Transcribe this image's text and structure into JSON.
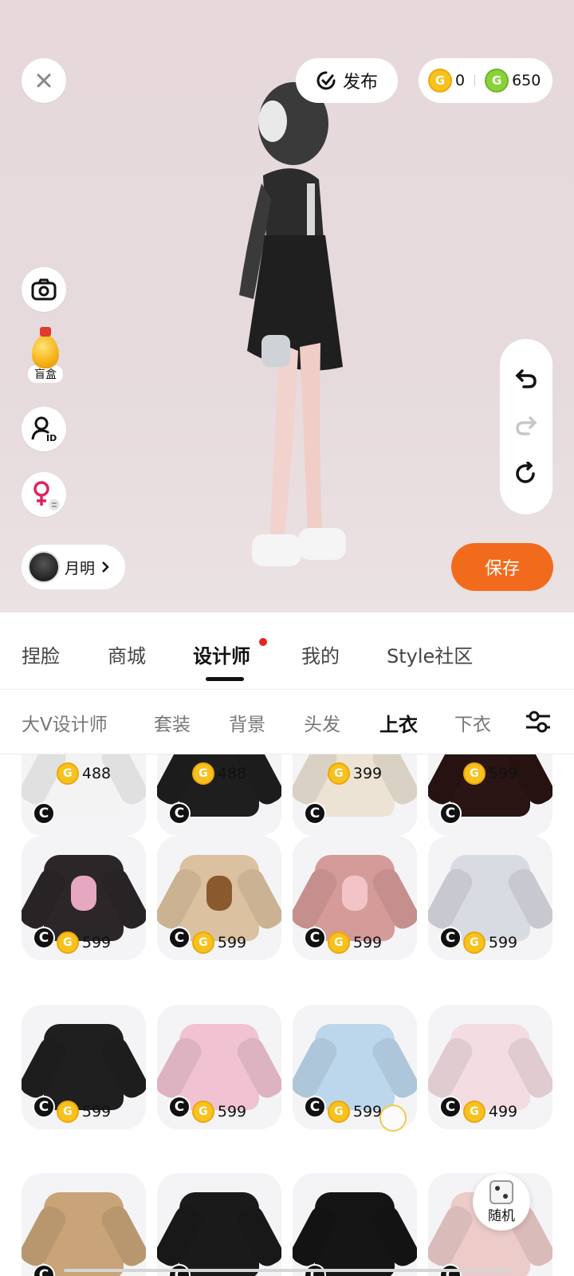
{
  "header": {
    "close_icon": "close-icon",
    "publish_label": "发布",
    "coins_gold": "0",
    "coins_green": "650"
  },
  "left_tools": {
    "camera_icon": "camera-icon",
    "blind_box_label": "盲盒",
    "id_icon": "user-id-icon",
    "gender_icon": "female-switch-icon"
  },
  "right_tools": {
    "undo_icon": "undo-icon",
    "redo_icon": "redo-icon",
    "reset_icon": "reset-icon"
  },
  "user": {
    "name": "月明"
  },
  "save_label": "保存",
  "main_tabs": [
    {
      "label": "捏脸"
    },
    {
      "label": "商城"
    },
    {
      "label": "设计师"
    },
    {
      "label": "我的"
    },
    {
      "label": "Style社区"
    }
  ],
  "sub_tabs": [
    {
      "label": "大V设计师"
    },
    {
      "label": "套装"
    },
    {
      "label": "背景"
    },
    {
      "label": "头发"
    },
    {
      "label": "上衣"
    },
    {
      "label": "下衣"
    }
  ],
  "items": [
    {
      "price": "488",
      "color": "#f3f3f3"
    },
    {
      "price": "488",
      "color": "#1e1e1e"
    },
    {
      "price": "399",
      "color": "#ece3d4"
    },
    {
      "price": "599",
      "color": "#2a1414"
    },
    {
      "price": "599",
      "color": "#2b2628"
    },
    {
      "price": "599",
      "color": "#dcc1a0"
    },
    {
      "price": "599",
      "color": "#d59b98"
    },
    {
      "price": "599",
      "color": "#d9dbe2"
    },
    {
      "price": "599",
      "color": "#1f1f1f"
    },
    {
      "price": "599",
      "color": "#f0c2d2"
    },
    {
      "price": "599",
      "color": "#bcd7ec"
    },
    {
      "price": "499",
      "color": "#f3dde2"
    },
    {
      "price": "",
      "color": "#c9a478"
    },
    {
      "price": "",
      "color": "#1a1a1a"
    },
    {
      "price": "",
      "color": "#151515"
    },
    {
      "price": "",
      "color": "#eccbc9"
    }
  ],
  "random_label": "随机",
  "coin_symbol": "G",
  "creator_symbol": "C"
}
